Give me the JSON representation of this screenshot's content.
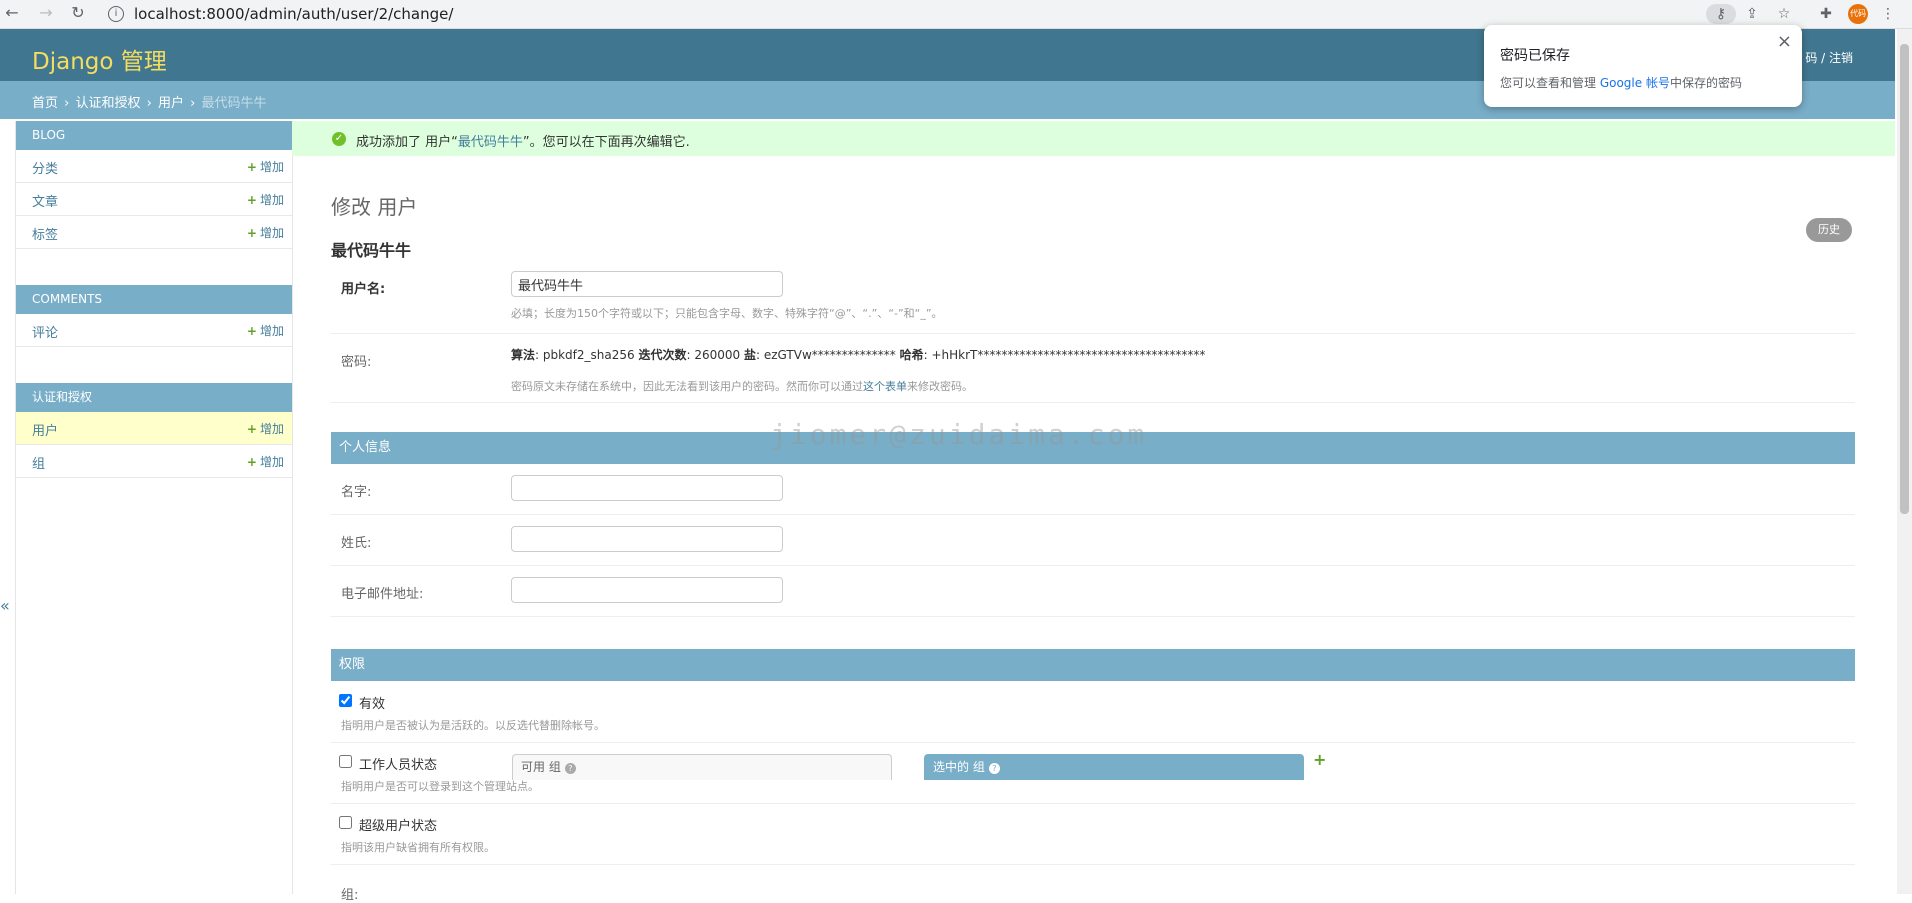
{
  "browser": {
    "back_icon": "arrow-left-icon",
    "url": "localhost:8000/admin/auth/user/2/change/",
    "avatar_text": "代码"
  },
  "password_popup": {
    "title": "密码已保存",
    "body_prefix": "您可以查看和管理 ",
    "body_link": "Google 帐号",
    "body_suffix": "中保存的密码",
    "close": "×"
  },
  "header": {
    "brand": "Django 管理",
    "userlinks": "码 / 注销"
  },
  "breadcrumbs": {
    "home": "首页",
    "app": "认证和授权",
    "model": "用户",
    "current": "最代码牛牛",
    "sep": "›"
  },
  "sidebar": {
    "modules": [
      {
        "caption": "BLOG",
        "items": [
          {
            "label": "分类",
            "add": "增加"
          },
          {
            "label": "文章",
            "add": "增加"
          },
          {
            "label": "标签",
            "add": "增加"
          }
        ]
      },
      {
        "caption": "COMMENTS",
        "items": [
          {
            "label": "评论",
            "add": "增加"
          }
        ]
      },
      {
        "caption": "认证和授权",
        "items": [
          {
            "label": "用户",
            "add": "增加"
          },
          {
            "label": "组",
            "add": "增加"
          }
        ]
      }
    ],
    "collapse": "«"
  },
  "message": {
    "prefix": "成功添加了 用户“",
    "name": "最代码牛牛",
    "suffix": "”。您可以在下面再次编辑它."
  },
  "page": {
    "title": "修改 用户",
    "object_name": "最代码牛牛",
    "history": "历史"
  },
  "form": {
    "username_label": "用户名:",
    "username_value": "最代码牛牛",
    "username_help": "必填；长度为150个字符或以下；只能包含字母、数字、特殊字符“@”、“.”、“-”和“_”。",
    "password_label": "密码:",
    "pw_algo_label": "算法",
    "pw_algo": "pbkdf2_sha256",
    "pw_iter_label": "迭代次数",
    "pw_iter": "260000",
    "pw_salt_label": "盐",
    "pw_salt": "ezGTVw**************",
    "pw_hash_label": "哈希",
    "pw_hash": "+hHkrT**************************************",
    "pw_help_prefix": "密码原文未存储在系统中，因此无法看到该用户的密码。然而你可以通过",
    "pw_help_link": "这个表单",
    "pw_help_suffix": "来修改密码。"
  },
  "personal": {
    "caption": "个人信息",
    "first_name_label": "名字:",
    "last_name_label": "姓氏:",
    "email_label": "电子邮件地址:"
  },
  "permissions": {
    "caption": "权限",
    "active_label": "有效",
    "active_help": "指明用户是否被认为是活跃的。以反选代替删除帐号。",
    "staff_label": "工作人员状态",
    "staff_help": "指明用户是否可以登录到这个管理站点。",
    "super_label": "超级用户状态",
    "super_help": "指明该用户缺省拥有所有权限。",
    "groups_label": "组:",
    "available_groups": "可用 组",
    "chosen_groups": "选中的 组",
    "qmark": "?",
    "add": "+"
  },
  "watermark": "jiomer@zuidaima.com"
}
